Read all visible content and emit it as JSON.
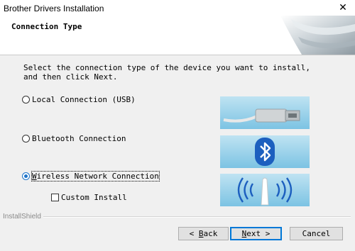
{
  "window": {
    "title": "Brother Drivers Installation",
    "close_glyph": "✕"
  },
  "header": {
    "heading": "Connection Type"
  },
  "instruction": "Select the connection type of the device you want to install, and then click Next.",
  "options": [
    {
      "label": "Local Connection (USB)",
      "selected": false,
      "icon": "usb-cable-icon"
    },
    {
      "label": "Bluetooth Connection",
      "selected": false,
      "icon": "bluetooth-icon"
    },
    {
      "label": "Wireless Network Connection",
      "selected": true,
      "icon": "wireless-icon"
    }
  ],
  "custom_install": {
    "label": "Custom Install",
    "checked": false
  },
  "footer": {
    "brand": "InstallShield"
  },
  "buttons": {
    "back": {
      "prefix": "< ",
      "mnemonic": "B",
      "rest": "ack"
    },
    "next": {
      "mnemonic": "N",
      "rest": "ext >"
    },
    "cancel": "Cancel"
  },
  "colors": {
    "accent": "#1e74c9",
    "tile_top": "#bfe3f2",
    "tile_bottom": "#7cc3e3"
  }
}
